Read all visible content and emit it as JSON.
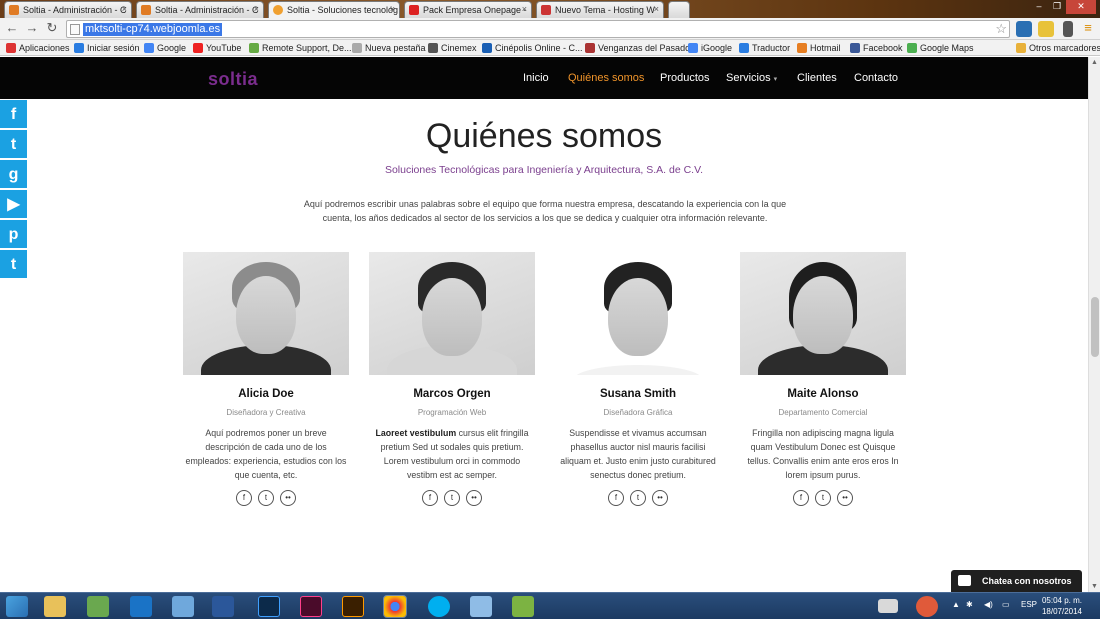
{
  "browser": {
    "tabs": [
      {
        "title": "Soltia - Administración - C",
        "color": "#e07b24"
      },
      {
        "title": "Soltia - Administración - C",
        "color": "#e07b24"
      },
      {
        "title": "Soltia - Soluciones tecnológ",
        "color": "#f0a030"
      },
      {
        "title": "Pack Empresa Onepage -",
        "color": "#d22"
      },
      {
        "title": "Nuevo Tema - Hosting W",
        "color": "#c33"
      }
    ],
    "url": "mktsolti-cp74.webjoomla.es",
    "bookmarks": [
      {
        "label": "Aplicaciones",
        "color": "#d33"
      },
      {
        "label": "Iniciar sesión",
        "color": "#2a7de1"
      },
      {
        "label": "Google",
        "color": "#4285f4"
      },
      {
        "label": "YouTube",
        "color": "#e22"
      },
      {
        "label": "Remote Support, De...",
        "color": "#6a4"
      },
      {
        "label": "Nueva pestaña",
        "color": "#aaa"
      },
      {
        "label": "Cinemex",
        "color": "#555"
      },
      {
        "label": "Cinépolis Online - C...",
        "color": "#1a5fb4"
      },
      {
        "label": "Venganzas del Pasado",
        "color": "#a33"
      },
      {
        "label": "iGoogle",
        "color": "#4285f4"
      },
      {
        "label": "Traductor",
        "color": "#2a7de1"
      },
      {
        "label": "Hotmail",
        "color": "#e67e22"
      },
      {
        "label": "Facebook",
        "color": "#3b5998"
      },
      {
        "label": "Google Maps",
        "color": "#4caf50"
      }
    ],
    "other_bookmarks": "Otros marcadores"
  },
  "site": {
    "logo": "soltia",
    "menu": [
      "Inicio",
      "Quiénes somos",
      "Productos",
      "Servicios",
      "Clientes",
      "Contacto"
    ],
    "menu_active": "Quiénes somos",
    "social_icons": [
      "f",
      "t",
      "g",
      "▶",
      "p",
      "t"
    ],
    "title": "Quiénes somos",
    "subtitle": "Soluciones Tecnológicas para Ingeniería y Arquitectura, S.A. de C.V.",
    "intro_line1": "Aquí podremos escribir unas palabras sobre el equipo que forma nuestra empresa, descatando la experiencia con la que",
    "intro_line2": "cuenta, los años dedicados al sector de los servicios a los que se dedica y cualquier otra información relevante.",
    "team": [
      {
        "name": "Alicia Doe",
        "role": "Diseñadora y Creativa",
        "bold": "",
        "desc": "Aquí podremos poner un breve descripción de cada uno de los empleados: experiencia, estudios con los que cuenta, etc."
      },
      {
        "name": "Marcos Orgen",
        "role": "Programación Web",
        "bold": "Laoreet vestibulum",
        "desc": " cursus elit fringilla pretium Sed ut sodales quis pretium. Lorem vestibulum orci in commodo vestibm est ac semper."
      },
      {
        "name": "Susana Smith",
        "role": "Diseñadora Gráfica",
        "bold": "",
        "desc": "Suspendisse et vivamus accumsan phasellus auctor nisl mauris facilisi aliquam et. Justo enim justo curabitured senectus donec pretium."
      },
      {
        "name": "Maite Alonso",
        "role": "Departamento Comercial",
        "bold": "",
        "desc": "Fringilla non adipiscing magna ligula quam Vestibulum Donec est Quisque tellus. Convallis enim ante eros eros In lorem ipsum purus."
      }
    ],
    "chat_label": "Chatea con nosotros"
  },
  "taskbar": {
    "lang": "ESP",
    "time": "05:04 p. m.",
    "date": "18/07/2014"
  }
}
